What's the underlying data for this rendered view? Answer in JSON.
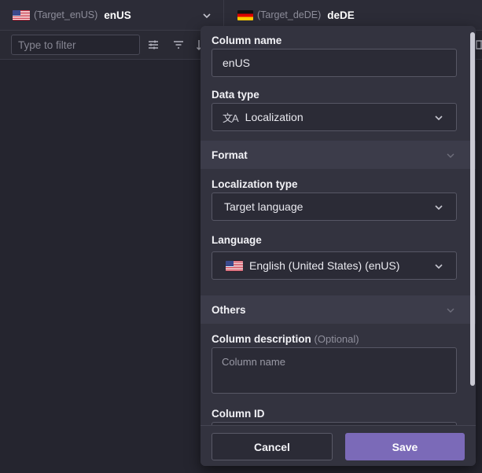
{
  "columns": [
    {
      "flag": "us-flag",
      "target": "(Target_enUS)",
      "locale": "enUS"
    },
    {
      "flag": "de-flag",
      "target": "(Target_deDE)",
      "locale": "deDE"
    }
  ],
  "filter": {
    "placeholder": "Type to filter",
    "icons": [
      "sliders-icon",
      "filter-icon",
      "sort-icon"
    ]
  },
  "panel": {
    "column_name": {
      "label": "Column name",
      "value": "enUS"
    },
    "data_type": {
      "label": "Data type",
      "icon": "translate-icon",
      "icon_glyph": "文A",
      "value": "Localization"
    },
    "format_section": {
      "title": "Format"
    },
    "localization_type": {
      "label": "Localization type",
      "value": "Target language"
    },
    "language": {
      "label": "Language",
      "flag": "us-flag",
      "value": "English (United States) (enUS)"
    },
    "others_section": {
      "title": "Others"
    },
    "column_description": {
      "label": "Column description",
      "optional": "(Optional)",
      "placeholder": "Column name"
    },
    "column_id": {
      "label": "Column ID"
    },
    "cancel": "Cancel",
    "save": "Save"
  },
  "colors": {
    "accent": "#7b6ab8",
    "panel": "#33333f",
    "background": "#25252f"
  }
}
